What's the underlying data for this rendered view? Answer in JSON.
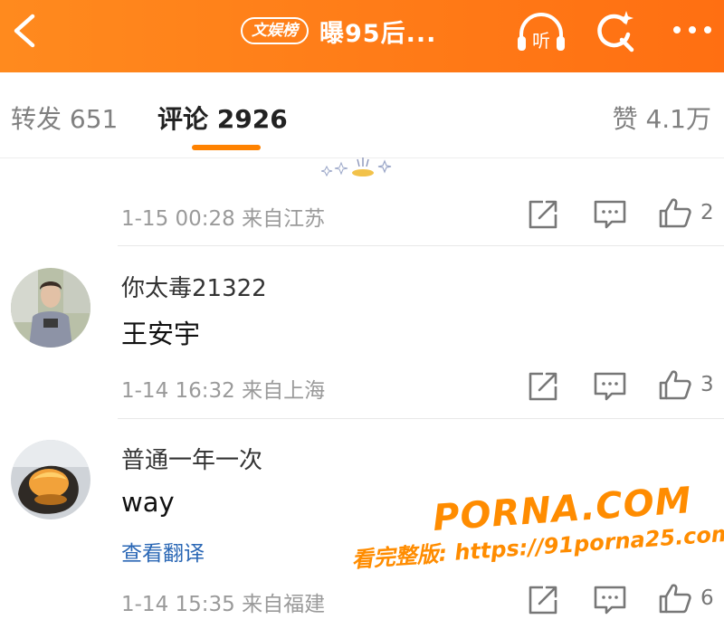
{
  "colors": {
    "brand_orange": "#ff8200",
    "link_blue": "#2a67b5",
    "meta_gray": "#9a9a9a"
  },
  "header": {
    "badge": "文娱榜",
    "title": "曝95后...",
    "icons": [
      "back-icon",
      "listen-icon",
      "search-icon",
      "more-icon"
    ],
    "listen_label": "听"
  },
  "tabs": {
    "repost": "转发 651",
    "comment": "评论 2926",
    "like": "赞 4.1万"
  },
  "comments": [
    {
      "timestamp": "1-15 00:28 来自江苏",
      "likes": "2"
    },
    {
      "username": "你太毒21322",
      "text": "王安宇",
      "timestamp": "1-14 16:32 来自上海",
      "likes": "3"
    },
    {
      "username": "普通一年一次",
      "text": "way",
      "translate": "查看翻译",
      "timestamp": "1-14 15:35 来自福建",
      "likes": "6"
    }
  ],
  "watermark": {
    "logo": "PORNA.COM",
    "url": "看完整版: https://91porna25.com"
  }
}
